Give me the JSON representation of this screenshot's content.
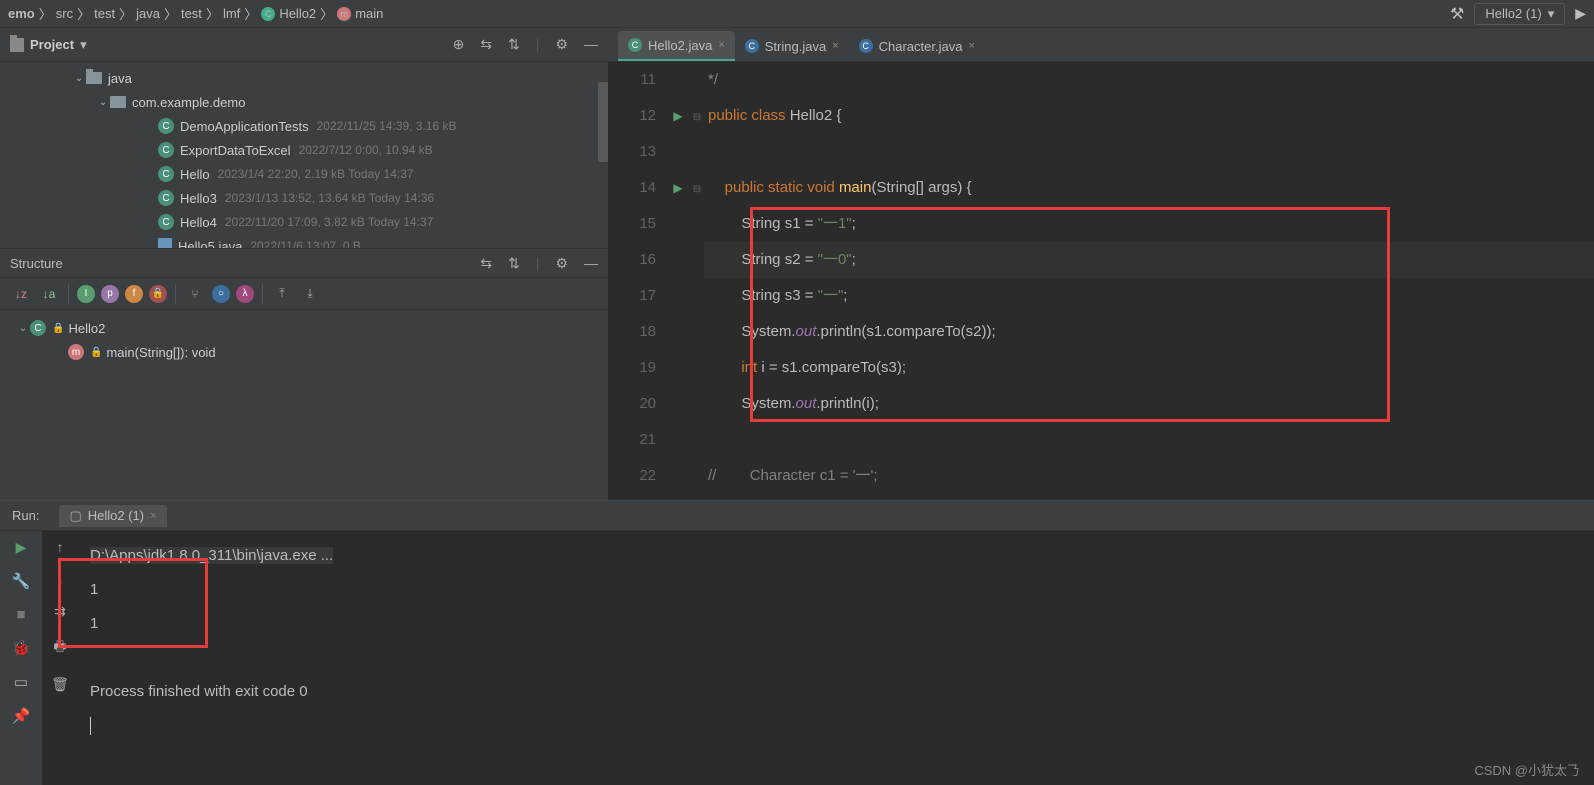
{
  "breadcrumb": {
    "items": [
      "emo",
      "src",
      "test",
      "java",
      "test",
      "lmf",
      "Hello2",
      "main"
    ]
  },
  "runConfig": {
    "name": "Hello2 (1)"
  },
  "project": {
    "title": "Project",
    "tree": [
      {
        "indent": "p1",
        "arrow": "⌄",
        "kind": "folder",
        "name": "java",
        "meta": ""
      },
      {
        "indent": "p2",
        "arrow": "⌄",
        "kind": "pkg",
        "name": "com.example.demo",
        "meta": ""
      },
      {
        "indent": "p3",
        "arrow": "",
        "kind": "class",
        "name": "DemoApplicationTests",
        "meta": "2022/11/25 14:39, 3.16 kB"
      },
      {
        "indent": "p3",
        "arrow": "",
        "kind": "class",
        "name": "ExportDataToExcel",
        "meta": "2022/7/12 0:00, 10.94 kB"
      },
      {
        "indent": "p3",
        "arrow": "",
        "kind": "class",
        "name": "Hello",
        "meta": "2023/1/4 22:20, 2.19 kB Today 14:37"
      },
      {
        "indent": "p3",
        "arrow": "",
        "kind": "class",
        "name": "Hello3",
        "meta": "2023/1/13 13:52, 13.64 kB Today 14:36"
      },
      {
        "indent": "p3",
        "arrow": "",
        "kind": "class",
        "name": "Hello4",
        "meta": "2022/11/20 17:09, 3.82 kB Today 14:37"
      },
      {
        "indent": "p3",
        "arrow": "",
        "kind": "jfile",
        "name": "Hello5.java",
        "meta": "2022/11/6 13:07, 0 B"
      }
    ]
  },
  "structure": {
    "title": "Structure",
    "tree": [
      {
        "indent": "p0a",
        "arrow": "⌄",
        "kind": "class",
        "name": "Hello2",
        "badge": true
      },
      {
        "indent": "p0b",
        "arrow": "",
        "kind": "method",
        "name": "main(String[]): void",
        "badge": true
      }
    ]
  },
  "tabs": [
    {
      "label": "Hello2.java",
      "icon": "c",
      "active": true
    },
    {
      "label": "String.java",
      "icon": "lib",
      "active": false
    },
    {
      "label": "Character.java",
      "icon": "lib",
      "active": false
    }
  ],
  "editor": {
    "startLine": 11,
    "lines": [
      {
        "n": 11,
        "play": false,
        "fold": "",
        "html": "*/",
        "cls": "cmt"
      },
      {
        "n": 12,
        "play": true,
        "fold": "⊟",
        "html": "<span class='kw'>public class</span> Hello2 {"
      },
      {
        "n": 13,
        "play": false,
        "fold": "",
        "html": ""
      },
      {
        "n": 14,
        "play": true,
        "fold": "⊟",
        "html": "    <span class='kw'>public</span> <span class='kw'>static</span> <span class='kw'>void</span> <span class='fn'>main</span>(String[] args) {"
      },
      {
        "n": 15,
        "play": false,
        "fold": "",
        "html": "        String s1 = <span class='str'>\"一1\"</span>;"
      },
      {
        "n": 16,
        "play": false,
        "fold": "",
        "html": "        String s2 = <span class='str'>\"一0\"</span>;",
        "curr": true
      },
      {
        "n": 17,
        "play": false,
        "fold": "",
        "html": "        String s3 = <span class='str'>\"一\"</span>;"
      },
      {
        "n": 18,
        "play": false,
        "fold": "",
        "html": "        System.<span class='field'>out</span>.println(s1.compareTo(s2));"
      },
      {
        "n": 19,
        "play": false,
        "fold": "",
        "html": "        <span class='kw'>int</span> i = s1.compareTo(s3);"
      },
      {
        "n": 20,
        "play": false,
        "fold": "",
        "html": "        System.<span class='field'>out</span>.println(i);"
      },
      {
        "n": 21,
        "play": false,
        "fold": "",
        "html": ""
      },
      {
        "n": 22,
        "play": false,
        "fold": "",
        "html": "<span class='cmt'>//</span>        <span class='cmt'>Character c1 = '一';</span>"
      }
    ]
  },
  "run": {
    "label": "Run:",
    "tab": "Hello2 (1)",
    "console": [
      {
        "text": "D:\\Apps\\jdk1.8.0_311\\bin\\java.exe ...",
        "cmd": true
      },
      {
        "text": "1"
      },
      {
        "text": "1"
      },
      {
        "text": ""
      },
      {
        "text": "Process finished with exit code 0"
      }
    ]
  },
  "watermark": "CSDN @小犹太𠄎"
}
